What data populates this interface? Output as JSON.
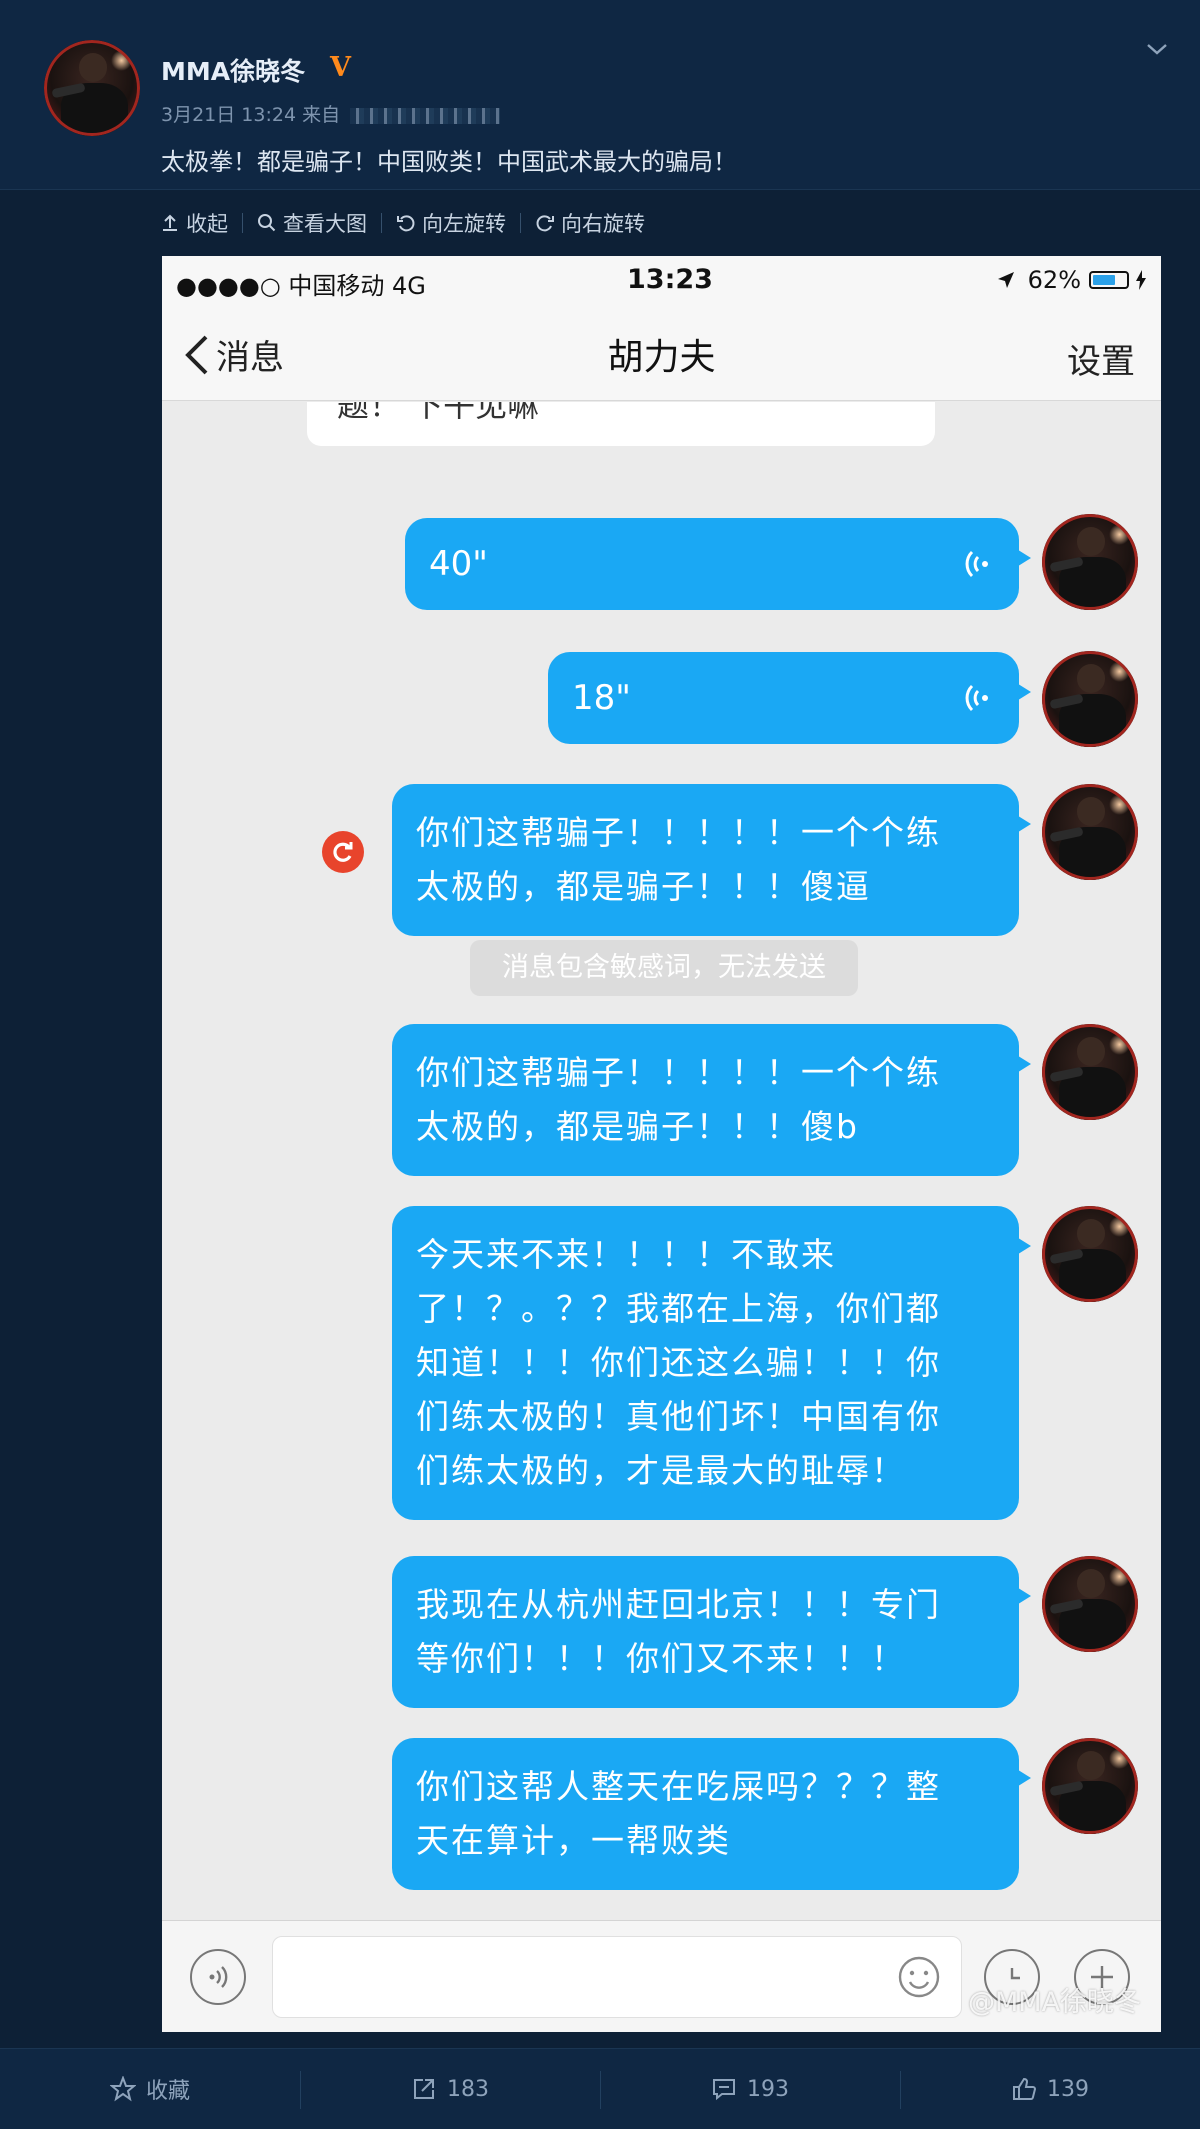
{
  "post": {
    "author": "MMA徐晓冬",
    "verified_mark": "V",
    "meta": "3月21日 13:24 来自",
    "text": "太极拳！都是骗子！中国败类！中国武术最大的骗局！"
  },
  "toolbar": {
    "collapse": "收起",
    "view_large": "查看大图",
    "rotate_left": "向左旋转",
    "rotate_right": "向右旋转"
  },
  "phone": {
    "status": {
      "carrier": "●●●●○ 中国移动   4G",
      "time": "13:23",
      "battery": "62%"
    },
    "nav": {
      "back": "消息",
      "title": "胡力夫",
      "settings": "设置"
    },
    "prev_message_fragment": "题！  下午见嘛",
    "messages": [
      {
        "type": "voice",
        "duration": "40\""
      },
      {
        "type": "voice",
        "duration": "18\""
      },
      {
        "type": "text",
        "lines": [
          "你们这帮骗子！！！！！一个个练",
          "太极的，都是骗子！！！傻逼"
        ],
        "failed": true
      },
      {
        "type": "text",
        "lines": [
          "你们这帮骗子！！！！！一个个练",
          "太极的，都是骗子！！！傻b"
        ]
      },
      {
        "type": "text",
        "lines": [
          "今天来不来！！！！不敢来",
          "了！？。？？我都在上海，你们都",
          "知道！！！你们还这么骗！！！你",
          "们练太极的！真他们坏！中国有你",
          "们练太极的，才是最大的耻辱！"
        ]
      },
      {
        "type": "text",
        "lines": [
          "我现在从杭州赶回北京！！！专门",
          "等你们！！！你们又不来！！！"
        ]
      },
      {
        "type": "text",
        "lines": [
          "你们这帮人整天在吃屎吗？？？整",
          "天在算计，一帮败类"
        ]
      }
    ],
    "system_note": "消息包含敏感词，无法发送",
    "watermark": "@MMA徐晓冬"
  },
  "actions": {
    "favorite": "收藏",
    "repost": "183",
    "comment": "193",
    "like": "139"
  },
  "colors": {
    "page_bg": "#0d2036",
    "bubble": "#1aa8f4",
    "verified": "#ff8a1c"
  }
}
